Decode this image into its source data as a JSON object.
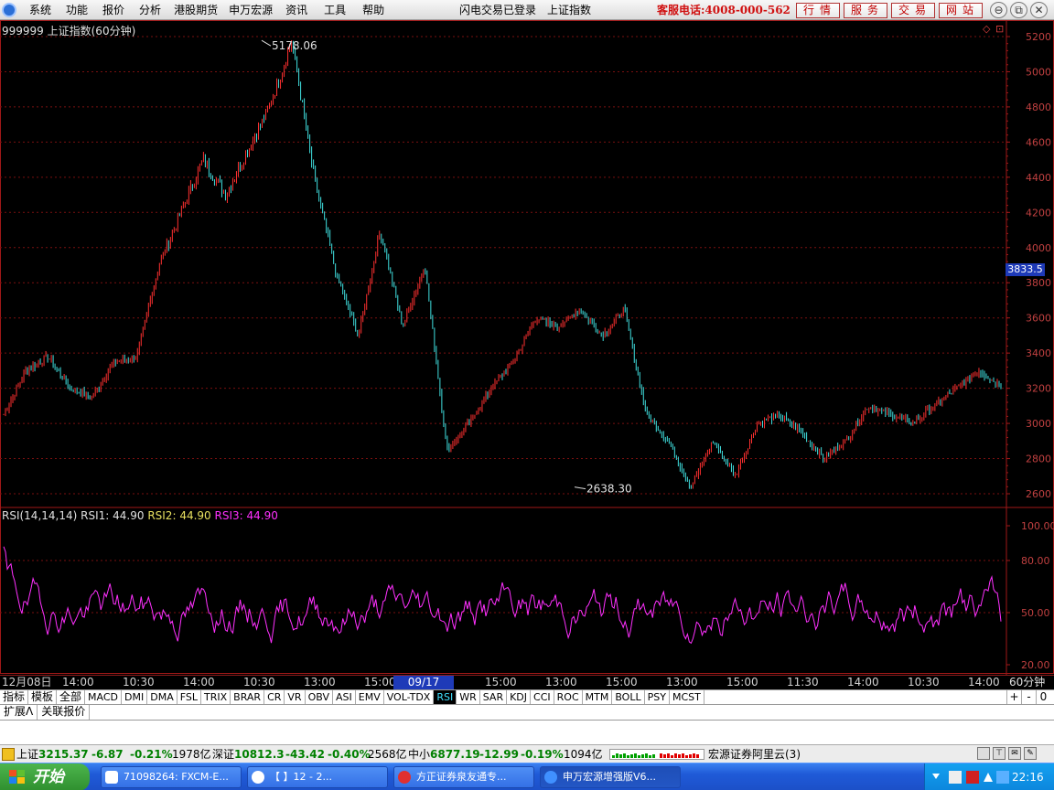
{
  "menu": {
    "items": [
      "系统",
      "功能",
      "报价",
      "分析",
      "港股期货",
      "申万宏源",
      "资讯",
      "工具",
      "帮助"
    ],
    "login_status": "闪电交易已登录",
    "current_index": "上证指数",
    "hotline": "客服电话:4008-000-562",
    "quick_buttons": [
      "行情",
      "服务",
      "交易",
      "网站"
    ]
  },
  "chart_header": {
    "title": "999999 上证指数(60分钟)"
  },
  "price_axis": {
    "ticks": [
      "5200",
      "5000",
      "4800",
      "4600",
      "4400",
      "4200",
      "4000",
      "3800",
      "3600",
      "3400",
      "3200",
      "3000",
      "2800",
      "2600"
    ],
    "current_price": "3833.5"
  },
  "annotations": {
    "high": "5178.06",
    "low": "2638.30"
  },
  "rsi_panel": {
    "label": "RSI(14,14,14)",
    "rsi1_label": "RSI1:",
    "rsi1_value": "44.90",
    "rsi2_label": "RSI2:",
    "rsi2_value": "44.90",
    "rsi3_label": "RSI3:",
    "rsi3_value": "44.90",
    "ticks": [
      "100.00",
      "80.00",
      "50.00",
      "20.00"
    ]
  },
  "time_axis": {
    "labels": [
      "12月08日",
      "14:00",
      "10:30",
      "14:00",
      "10:30",
      "13:00",
      "15:00",
      "15:00",
      "13:00",
      "15:00",
      "13:00",
      "15:00",
      "11:30",
      "14:00",
      "10:30",
      "14:00"
    ],
    "highlight": "09/17 10:30",
    "period": "60分钟"
  },
  "indicator_tabs": [
    "指标",
    "模板",
    "全部",
    "MACD",
    "DMI",
    "DMA",
    "FSL",
    "TRIX",
    "BRAR",
    "CR",
    "VR",
    "OBV",
    "ASI",
    "EMV",
    "VOL-TDX",
    "RSI",
    "WR",
    "SAR",
    "KDJ",
    "CCI",
    "ROC",
    "MTM",
    "BOLL",
    "PSY",
    "MCST"
  ],
  "active_indicator": "RSI",
  "tab_controls": [
    "+",
    "-",
    "0"
  ],
  "sub_tabs": [
    "扩展A",
    "关联报价"
  ],
  "status_bar": {
    "sh_label": "上证",
    "sh_value": "3215.37",
    "sh_change": "-6.87",
    "sh_pct": "-0.21%",
    "sh_amount": "1978亿",
    "sz_label": "深证",
    "sz_value": "10812.3",
    "sz_change": "-43.42",
    "sz_pct": "-0.40%",
    "sz_amount": "2568亿",
    "zx_label": "中小",
    "zx_value": "6877.19",
    "zx_change": "-12.99",
    "zx_pct": "-0.19%",
    "zx_amount": "1094亿",
    "broker": "宏源证券阿里云(3)"
  },
  "taskbar": {
    "start_label": "开始",
    "tasks": [
      "71098264: FXCM-E...",
      "【 】12 - 2...",
      "方正证券泉友通专...",
      "申万宏源增强版V6..."
    ],
    "clock": "22:16"
  },
  "colors": {
    "up": "#ff3030",
    "down": "#40e0e0",
    "rsi": "#ff30ff",
    "axis": "#a01818",
    "highlight": "#1e3ab8"
  },
  "chart_data": {
    "type": "candlestick",
    "price_axis_range": [
      2600,
      5200
    ],
    "rsi_axis_range": [
      20,
      100
    ],
    "price_path_keypoints": [
      3050,
      3300,
      3380,
      3200,
      3150,
      3350,
      3380,
      3900,
      4200,
      4500,
      4300,
      4550,
      4800,
      5178.06,
      4400,
      3850,
      3500,
      4100,
      3550,
      3900,
      2850,
      3000,
      3200,
      3350,
      3600,
      3550,
      3650,
      3500,
      3650,
      3050,
      2900,
      2638.3,
      2900,
      2700,
      3000,
      3050,
      2950,
      2800,
      2900,
      3100,
      3050,
      3000,
      3100,
      3200,
      3300,
      3215.37
    ],
    "rsi_last": 44.9
  }
}
